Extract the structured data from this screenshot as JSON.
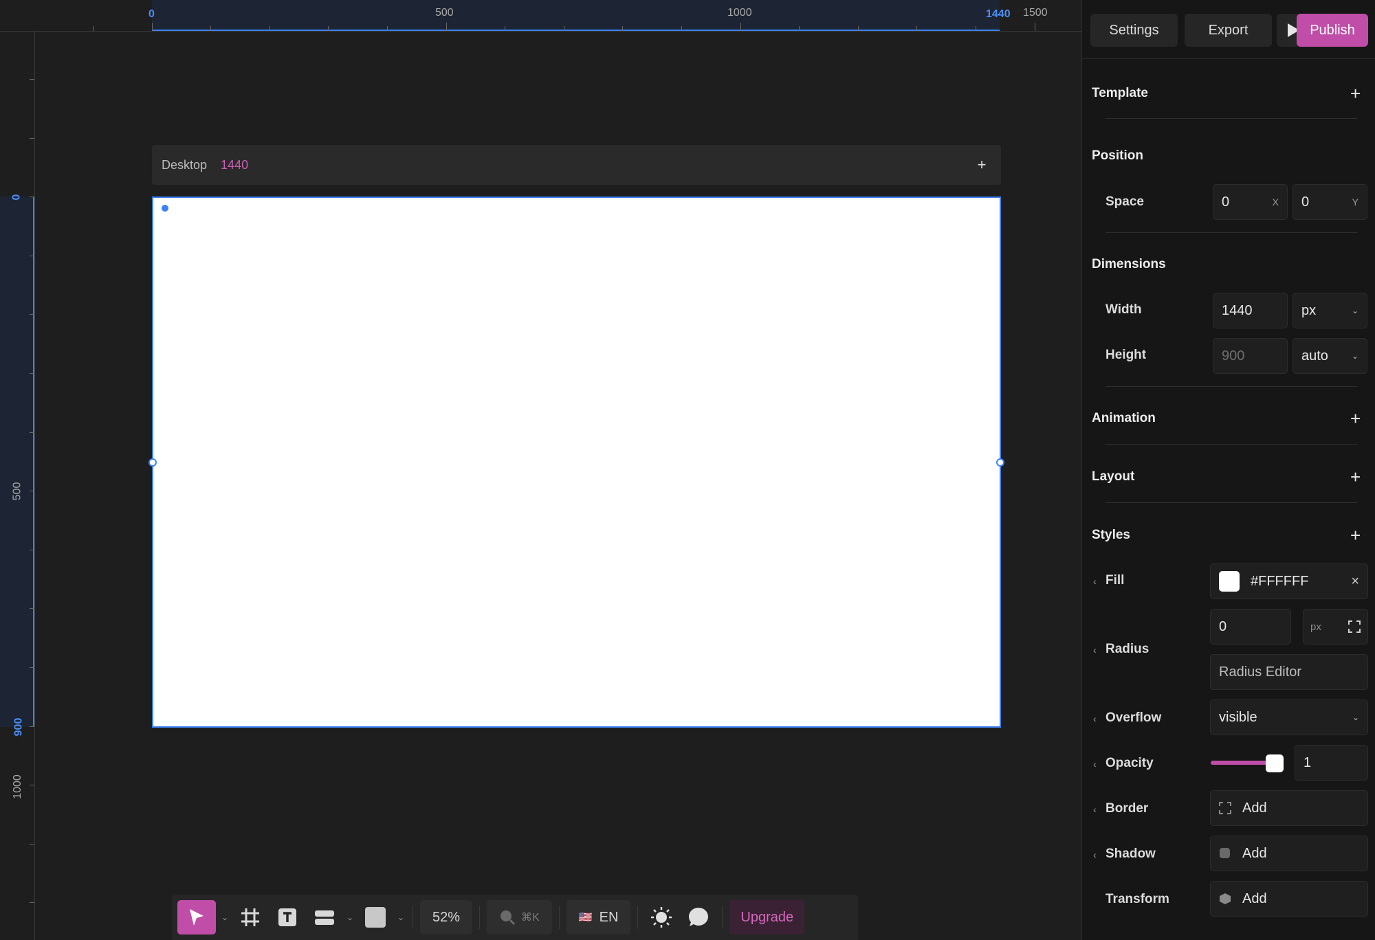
{
  "ruler": {
    "top_labels": [
      "0",
      "500",
      "1000",
      "1440",
      "1500"
    ],
    "left_labels": [
      "0",
      "500",
      "900",
      "1000"
    ]
  },
  "frame": {
    "name": "Desktop",
    "width_label": "1440",
    "add_label": "+"
  },
  "toolbar": {
    "zoom": "52%",
    "search_shortcut": "⌘K",
    "language": "EN",
    "language_flag": "🇺🇸",
    "upgrade_label": "Upgrade",
    "accent": "#c04ea8"
  },
  "topbar": {
    "settings_label": "Settings",
    "export_label": "Export",
    "play_icon": "play-icon",
    "publish_label": "Publish"
  },
  "panel": {
    "template": {
      "title": "Template",
      "add": "+"
    },
    "position": {
      "title": "Position",
      "space_label": "Space",
      "x_value": "0",
      "x_suffix": "X",
      "y_value": "0",
      "y_suffix": "Y"
    },
    "dimensions": {
      "title": "Dimensions",
      "width_label": "Width",
      "width_value": "1440",
      "width_unit": "px",
      "height_label": "Height",
      "height_value": "900",
      "height_unit": "auto"
    },
    "animation": {
      "title": "Animation",
      "add": "+"
    },
    "layout": {
      "title": "Layout",
      "add": "+"
    },
    "styles": {
      "title": "Styles",
      "add": "+",
      "fill_label": "Fill",
      "fill_value": "#FFFFFF",
      "fill_clear": "×",
      "radius_label": "Radius",
      "radius_value": "0",
      "radius_unit": "px",
      "radius_editor": "Radius Editor",
      "overflow_label": "Overflow",
      "overflow_value": "visible",
      "opacity_label": "Opacity",
      "opacity_value": "1",
      "opacity_level": 1,
      "border_label": "Border",
      "border_add": "Add",
      "shadow_label": "Shadow",
      "shadow_add": "Add",
      "transform_label": "Transform",
      "transform_add": "Add"
    }
  }
}
